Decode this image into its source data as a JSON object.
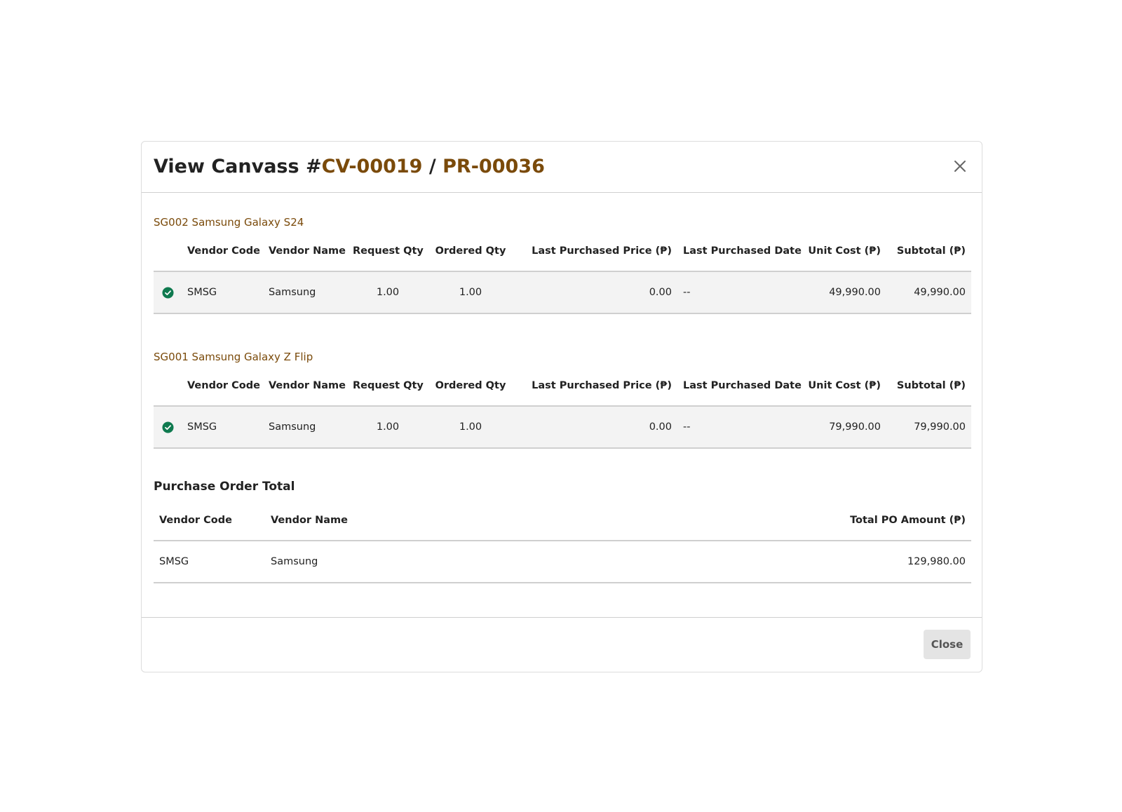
{
  "dialog": {
    "title_prefix": "View Canvass #",
    "canvass_no": "CV-00019",
    "separator": " / ",
    "pr_no": "PR-00036",
    "accent_color": "#7a4a0a",
    "close_icon": "close-icon",
    "close_label": "Close"
  },
  "columns": {
    "vendor_code": "Vendor Code",
    "vendor_name": "Vendor Name",
    "request_qty": "Request Qty",
    "ordered_qty": "Ordered Qty",
    "last_price": "Last Purchased Price (₱)",
    "last_date": "Last Purchased Date",
    "unit_cost": "Unit Cost (₱)",
    "subtotal": "Subtotal (₱)"
  },
  "items": [
    {
      "title": "SG002 Samsung Galaxy S24",
      "row": {
        "selected_icon": "check-circle-icon",
        "selected_color": "#0f7a4f",
        "vendor_code": "SMSG",
        "vendor_name": "Samsung",
        "request_qty": "1.00",
        "ordered_qty": "1.00",
        "last_price": "0.00",
        "last_date": "--",
        "unit_cost": "49,990.00",
        "subtotal": "49,990.00"
      }
    },
    {
      "title": "SG001 Samsung Galaxy Z Flip",
      "row": {
        "selected_icon": "check-circle-icon",
        "selected_color": "#0f7a4f",
        "vendor_code": "SMSG",
        "vendor_name": "Samsung",
        "request_qty": "1.00",
        "ordered_qty": "1.00",
        "last_price": "0.00",
        "last_date": "--",
        "unit_cost": "79,990.00",
        "subtotal": "79,990.00"
      }
    }
  ],
  "po_total": {
    "heading": "Purchase Order Total",
    "columns": {
      "vendor_code": "Vendor Code",
      "vendor_name": "Vendor Name",
      "total": "Total PO Amount (₱)"
    },
    "rows": [
      {
        "vendor_code": "SMSG",
        "vendor_name": "Samsung",
        "total": "129,980.00"
      }
    ]
  }
}
